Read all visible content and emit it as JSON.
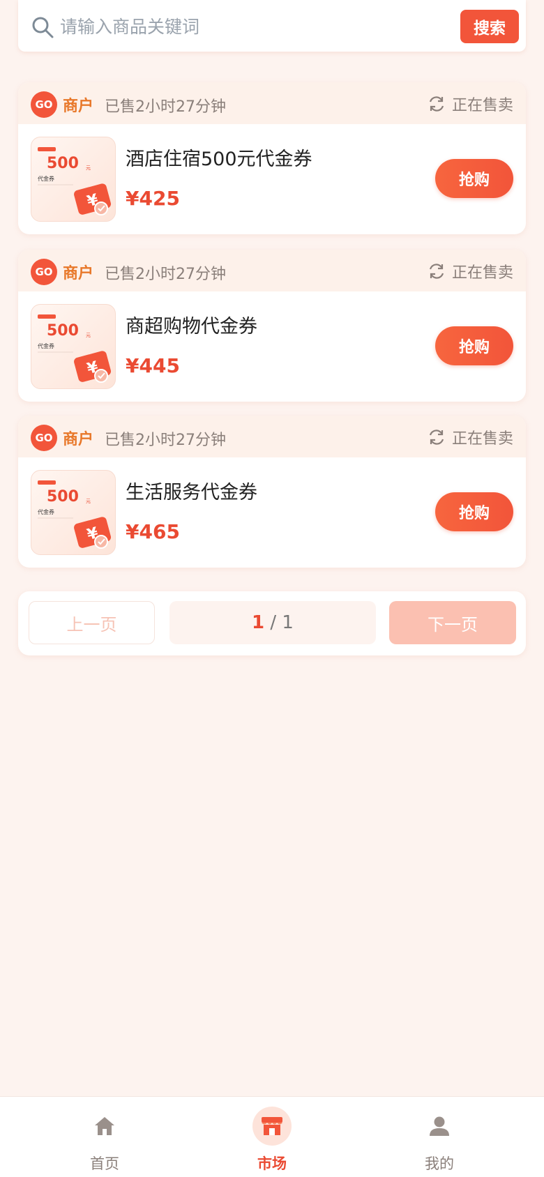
{
  "search": {
    "placeholder": "请输入商品关键词",
    "button_label": "搜索"
  },
  "products": [
    {
      "merchant_badge": "GO",
      "merchant_label": "商户",
      "sold_time": "已售2小时27分钟",
      "status": "正在售卖",
      "name": "酒店住宿500元代金券",
      "price": "¥425",
      "buy_label": "抢购",
      "thumb_amount": "500",
      "thumb_unit": "元",
      "thumb_title": "代金券"
    },
    {
      "merchant_badge": "GO",
      "merchant_label": "商户",
      "sold_time": "已售2小时27分钟",
      "status": "正在售卖",
      "name": "商超购物代金券",
      "price": "¥445",
      "buy_label": "抢购",
      "thumb_amount": "500",
      "thumb_unit": "元",
      "thumb_title": "代金券"
    },
    {
      "merchant_badge": "GO",
      "merchant_label": "商户",
      "sold_time": "已售2小时27分钟",
      "status": "正在售卖",
      "name": "生活服务代金券",
      "price": "¥465",
      "buy_label": "抢购",
      "thumb_amount": "500",
      "thumb_unit": "元",
      "thumb_title": "代金券"
    }
  ],
  "pagination": {
    "prev_label": "上一页",
    "current_page": "1",
    "separator": " / ",
    "total_pages": "1",
    "next_label": "下一页"
  },
  "tabbar": {
    "items": [
      {
        "label": "首页",
        "icon": "home-icon"
      },
      {
        "label": "市场",
        "icon": "store-icon",
        "active": true
      },
      {
        "label": "我的",
        "icon": "user-icon"
      }
    ]
  },
  "colors": {
    "accent": "#f2553a",
    "background": "#fdf3ef",
    "merchant": "#e8782a"
  }
}
